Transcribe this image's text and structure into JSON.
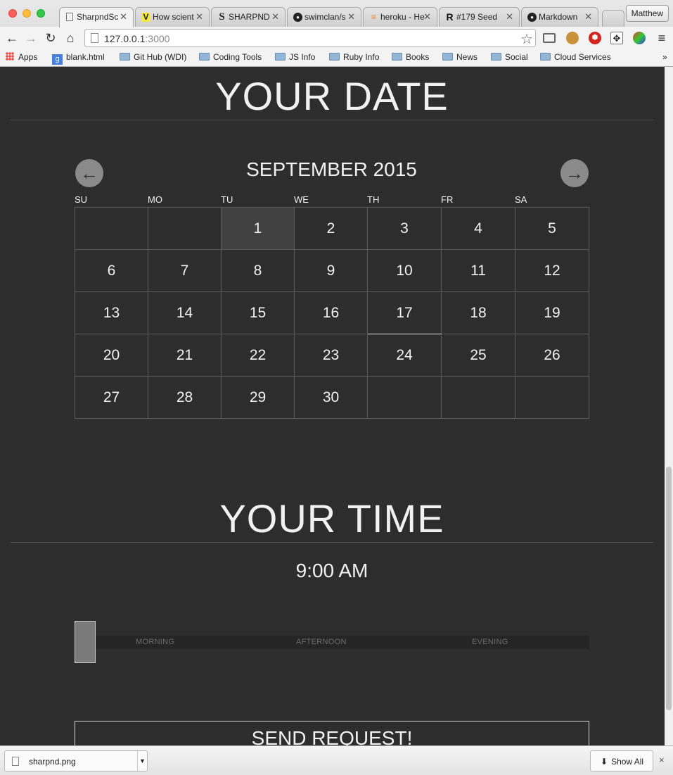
{
  "browser": {
    "tabs": [
      {
        "title": "SharpndSc",
        "icon": "page-icon",
        "active": true
      },
      {
        "title": "How scient",
        "icon": "verge-icon",
        "active": false
      },
      {
        "title": "SHARPND",
        "icon": "s-logo-icon",
        "active": false
      },
      {
        "title": "swimclan/s",
        "icon": "github-icon",
        "active": false
      },
      {
        "title": "heroku - He",
        "icon": "stackoverflow-icon",
        "active": false
      },
      {
        "title": "#179 Seed",
        "icon": "railscasts-icon",
        "active": false
      },
      {
        "title": "Markdown",
        "icon": "github-icon",
        "active": false
      }
    ],
    "profile_name": "Matthew",
    "url_host": "127.0.0.1",
    "url_port": ":3000",
    "bookmarks": [
      {
        "label": "Apps",
        "icon": "apps-grid-icon"
      },
      {
        "label": "blank.html",
        "icon": "google-icon"
      },
      {
        "label": "Git Hub (WDI)",
        "icon": "folder-icon"
      },
      {
        "label": "Coding Tools",
        "icon": "folder-icon"
      },
      {
        "label": "JS Info",
        "icon": "folder-icon"
      },
      {
        "label": "Ruby Info",
        "icon": "folder-icon"
      },
      {
        "label": "Books",
        "icon": "folder-icon"
      },
      {
        "label": "News",
        "icon": "folder-icon"
      },
      {
        "label": "Social",
        "icon": "folder-icon"
      },
      {
        "label": "Cloud Services",
        "icon": "folder-icon"
      }
    ],
    "more_bookmarks": "»"
  },
  "date_section": {
    "title": "YOUR DATE",
    "month_label": "SEPTEMBER 2015",
    "weekdays": [
      "SU",
      "MO",
      "TU",
      "WE",
      "TH",
      "FR",
      "SA"
    ],
    "weeks": [
      [
        "",
        "",
        "1",
        "2",
        "3",
        "4",
        "5"
      ],
      [
        "6",
        "7",
        "8",
        "9",
        "10",
        "11",
        "12"
      ],
      [
        "13",
        "14",
        "15",
        "16",
        "17",
        "18",
        "19"
      ],
      [
        "20",
        "21",
        "22",
        "23",
        "24",
        "25",
        "26"
      ],
      [
        "27",
        "28",
        "29",
        "30",
        "",
        "",
        ""
      ]
    ],
    "selected_day": "1",
    "today": "17"
  },
  "time_section": {
    "title": "YOUR TIME",
    "selected_time": "9:00 AM",
    "periods": [
      "MORNING",
      "AFTERNOON",
      "EVENING"
    ],
    "slider_position": 0
  },
  "send_button": "SEND REQUEST!",
  "downloads": {
    "file_name": "sharpnd.png",
    "show_all": "Show All",
    "close": "×"
  },
  "colors": {
    "background": "#2d2d2d",
    "text": "#f1f1f1",
    "grid_line": "#5a5a5a",
    "selected_cell": "#414141",
    "slider_handle": "#7a7a7a"
  }
}
